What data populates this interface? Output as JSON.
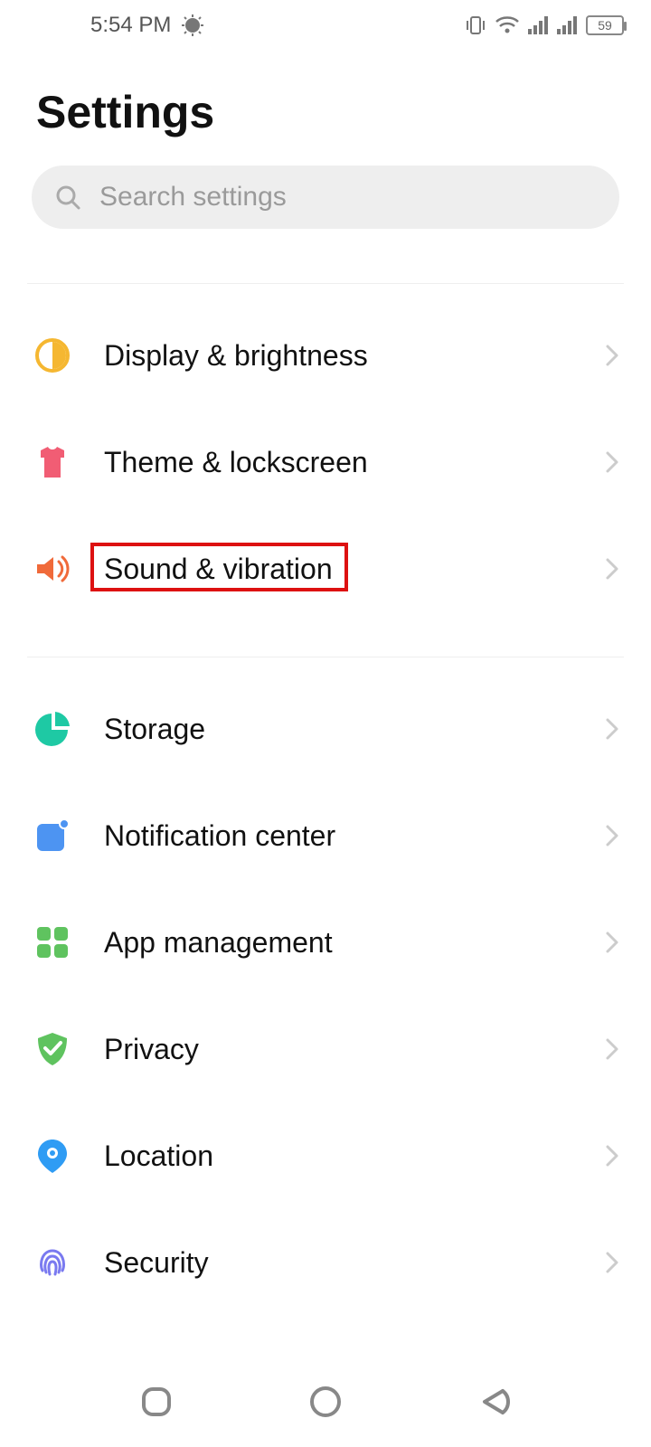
{
  "status": {
    "time": "5:54 PM",
    "battery": "59"
  },
  "header": {
    "title": "Settings"
  },
  "search": {
    "placeholder": "Search settings"
  },
  "groups": [
    {
      "items": [
        {
          "key": "display",
          "label": "Display & brightness",
          "icon": "brightness-icon",
          "color": "#f5b731",
          "highlighted": false
        },
        {
          "key": "theme",
          "label": "Theme & lockscreen",
          "icon": "shirt-icon",
          "color": "#f15d74",
          "highlighted": false
        },
        {
          "key": "sound",
          "label": "Sound & vibration",
          "icon": "speaker-icon",
          "color": "#f06a3a",
          "highlighted": true
        }
      ]
    },
    {
      "items": [
        {
          "key": "storage",
          "label": "Storage",
          "icon": "pie-icon",
          "color": "#1ec9a4",
          "highlighted": false
        },
        {
          "key": "notification",
          "label": "Notification center",
          "icon": "notification-icon",
          "color": "#4d94f2",
          "highlighted": false
        },
        {
          "key": "apps",
          "label": "App management",
          "icon": "apps-icon",
          "color": "#5fc35f",
          "highlighted": false
        },
        {
          "key": "privacy",
          "label": "Privacy",
          "icon": "shield-icon",
          "color": "#5fc35f",
          "highlighted": false
        },
        {
          "key": "location",
          "label": "Location",
          "icon": "location-icon",
          "color": "#2f9cf4",
          "highlighted": false
        },
        {
          "key": "security",
          "label": "Security",
          "icon": "fingerprint-icon",
          "color": "#7a7af0",
          "highlighted": false
        }
      ]
    }
  ]
}
